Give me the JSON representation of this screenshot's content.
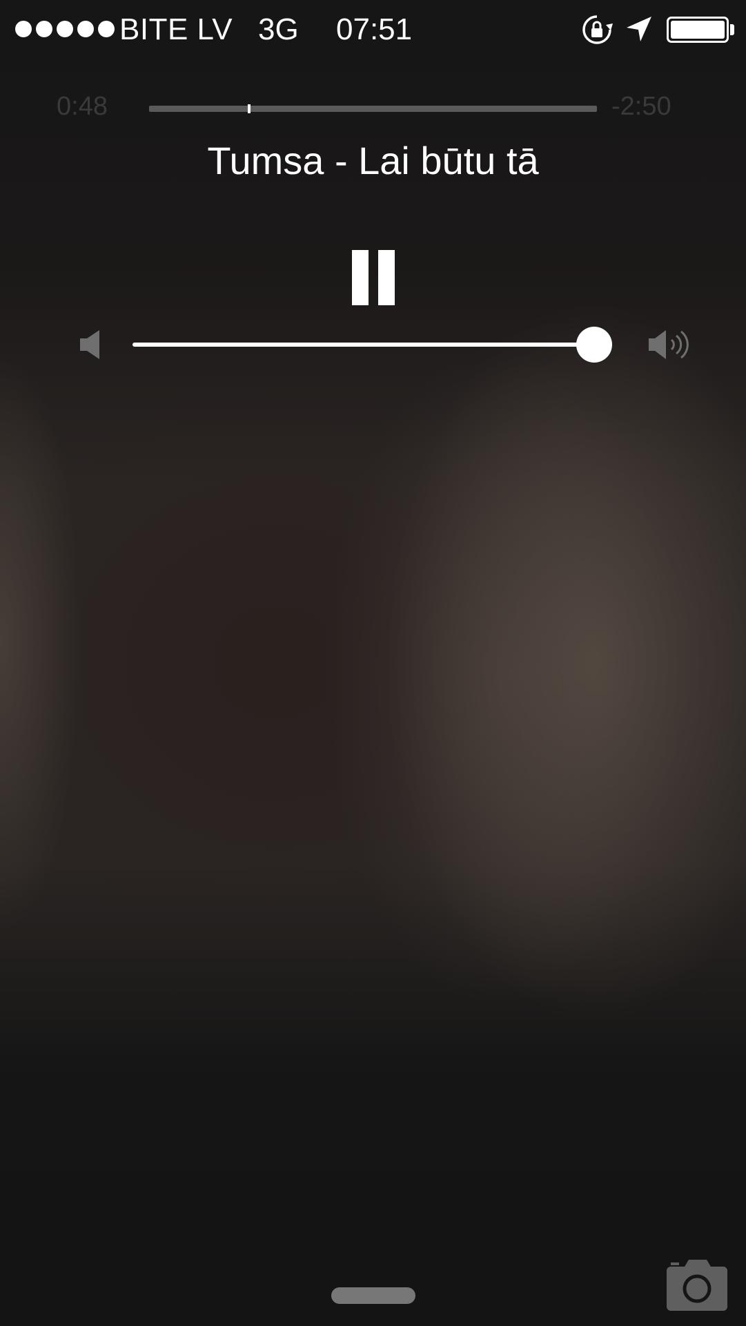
{
  "status_bar": {
    "signal_bars": 5,
    "carrier": "BITE LV",
    "network": "3G",
    "time": "07:51",
    "icons": [
      "rotation-lock-icon",
      "location-arrow-icon",
      "battery-icon"
    ],
    "battery_level": 1.0
  },
  "player": {
    "elapsed": "0:48",
    "remaining": "-2:50",
    "progress": 0.22,
    "title": "Tumsa - Lai būtu tā",
    "play_state_icon": "pause-icon",
    "volume_level": 0.97,
    "volume_icons": [
      "volume-low-icon",
      "volume-high-icon"
    ]
  },
  "bottom": {
    "icons": [
      "grabber-handle",
      "camera-icon"
    ]
  },
  "colors": {
    "background": "#141414",
    "foreground": "#ffffff",
    "dim_text": "#3a3a3a",
    "track": "#5a5a5a"
  }
}
